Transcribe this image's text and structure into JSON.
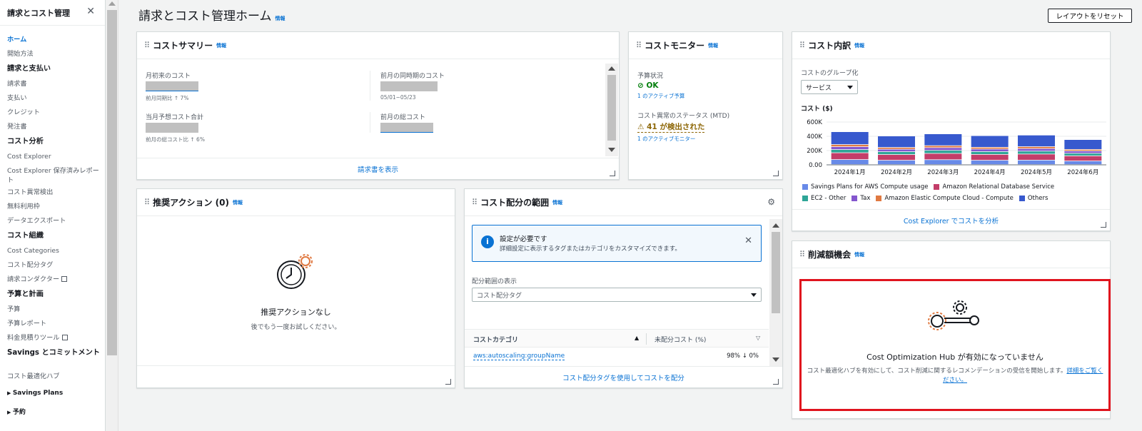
{
  "sidebar": {
    "title": "請求とコスト管理",
    "items": [
      {
        "label": "ホーム",
        "kind": "active"
      },
      {
        "label": "開始方法",
        "kind": "item"
      },
      {
        "label": "請求と支払い",
        "kind": "section"
      },
      {
        "label": "請求書",
        "kind": "item"
      },
      {
        "label": "支払い",
        "kind": "item"
      },
      {
        "label": "クレジット",
        "kind": "item"
      },
      {
        "label": "発注書",
        "kind": "item"
      },
      {
        "label": "コスト分析",
        "kind": "section"
      },
      {
        "label": "Cost Explorer",
        "kind": "item"
      },
      {
        "label": "Cost Explorer 保存済みレポート",
        "kind": "wrap"
      },
      {
        "label": "コスト異常検出",
        "kind": "item"
      },
      {
        "label": "無料利用枠",
        "kind": "item"
      },
      {
        "label": "データエクスポート",
        "kind": "item"
      },
      {
        "label": "コスト組織",
        "kind": "section"
      },
      {
        "label": "Cost Categories",
        "kind": "item"
      },
      {
        "label": "コスト配分タグ",
        "kind": "item"
      },
      {
        "label": "請求コンダクター",
        "kind": "external"
      },
      {
        "label": "予算と計画",
        "kind": "section"
      },
      {
        "label": "予算",
        "kind": "item"
      },
      {
        "label": "予算レポート",
        "kind": "item"
      },
      {
        "label": "料金見積りツール",
        "kind": "external"
      },
      {
        "label": "Savings とコミットメント",
        "kind": "wrap-section"
      },
      {
        "label": "コスト最適化ハブ",
        "kind": "item"
      },
      {
        "label": "Savings Plans",
        "kind": "expandable"
      },
      {
        "label": "予約",
        "kind": "expandable"
      }
    ]
  },
  "header": {
    "title": "請求とコスト管理ホーム",
    "info": "情報",
    "reset_button": "レイアウトをリセット"
  },
  "cost_summary": {
    "title": "コストサマリー",
    "info": "情報",
    "mtd_label": "月初来のコスト",
    "mtd_delta": "前月同期比 ↑ 7%",
    "prev_period_label": "前月の同時期のコスト",
    "prev_period_range": "05/01~05/23",
    "forecast_label": "当月予想コスト合計",
    "forecast_delta": "前月の総コスト比 ↑ 6%",
    "last_month_label": "前月の総コスト",
    "footer_link": "請求書を表示"
  },
  "cost_monitor": {
    "title": "コストモニター",
    "info": "情報",
    "budget_label": "予算状況",
    "budget_status": "OK",
    "budget_link": "1 のアクティブ予算",
    "anomaly_label": "コスト異常のステータス (MTD)",
    "anomaly_status": "41 が検出された",
    "anomaly_link": "1 のアクティブモニター"
  },
  "cost_breakdown": {
    "title": "コスト内訳",
    "info": "情報",
    "group_label": "コストのグループ化",
    "group_value": "サービス",
    "cost_label": "コスト ($)",
    "footer_link": "Cost Explorer でコストを分析"
  },
  "chart_data": {
    "type": "bar",
    "stacked": true,
    "categories": [
      "2024年1月",
      "2024年2月",
      "2024年3月",
      "2024年4月",
      "2024年5月",
      "2024年6月"
    ],
    "y_ticks": [
      "600K",
      "400K",
      "200K",
      "0.00"
    ],
    "ylim": [
      0,
      600000
    ],
    "grid": true,
    "legend_position": "bottom",
    "series": [
      {
        "name": "Savings Plans for AWS Compute usage",
        "color": "#688ae8",
        "values": [
          70000,
          60000,
          68000,
          60000,
          62000,
          50000
        ]
      },
      {
        "name": "Amazon Relational Database Service",
        "color": "#c33d69",
        "values": [
          95000,
          80000,
          88000,
          82000,
          85000,
          72000
        ]
      },
      {
        "name": "EC2 - Other",
        "color": "#2ea597",
        "values": [
          45000,
          40000,
          43000,
          40000,
          41000,
          36000
        ]
      },
      {
        "name": "Tax",
        "color": "#8456ce",
        "values": [
          40000,
          35000,
          38000,
          35000,
          36000,
          32000
        ]
      },
      {
        "name": "Amazon Elastic Compute Cloud - Compute",
        "color": "#e07941",
        "values": [
          30000,
          25000,
          28000,
          25000,
          27000,
          22000
        ]
      },
      {
        "name": "Others",
        "color": "#3759ce",
        "values": [
          180000,
          160000,
          165000,
          163000,
          162000,
          138000
        ]
      }
    ]
  },
  "recommended_actions": {
    "title": "推奨アクション (0)",
    "info": "情報",
    "empty_title": "推奨アクションなし",
    "empty_sub": "後でもう一度お試しください。"
  },
  "cost_allocation": {
    "title": "コスト配分の範囲",
    "info": "情報",
    "alert_title": "設定が必要です",
    "alert_body": "詳細設定に表示するタグまたはカテゴリをカスタマイズできます。",
    "scope_label": "配分範囲の表示",
    "scope_value": "コスト配分タグ",
    "col_category": "コストカテゴリ",
    "col_unallocated": "未配分コスト (%)",
    "row_name": "aws:autoscaling:groupName",
    "row_value": "98% ↓ 0%",
    "footer_link": "コスト配分タグを使用してコストを配分"
  },
  "savings": {
    "title": "削減額機会",
    "info": "情報",
    "hub_title": "Cost Optimization Hub が有効になっていません",
    "hub_body": "コスト最適化ハブを有効にして、コスト削減に関するレコメンデーションの受信を開始します。",
    "hub_link": "詳細をご覧ください。"
  },
  "colors": {
    "highlight": "#e0141e",
    "link": "#0972d3",
    "success": "#037f0c",
    "warning": "#8d6605"
  }
}
